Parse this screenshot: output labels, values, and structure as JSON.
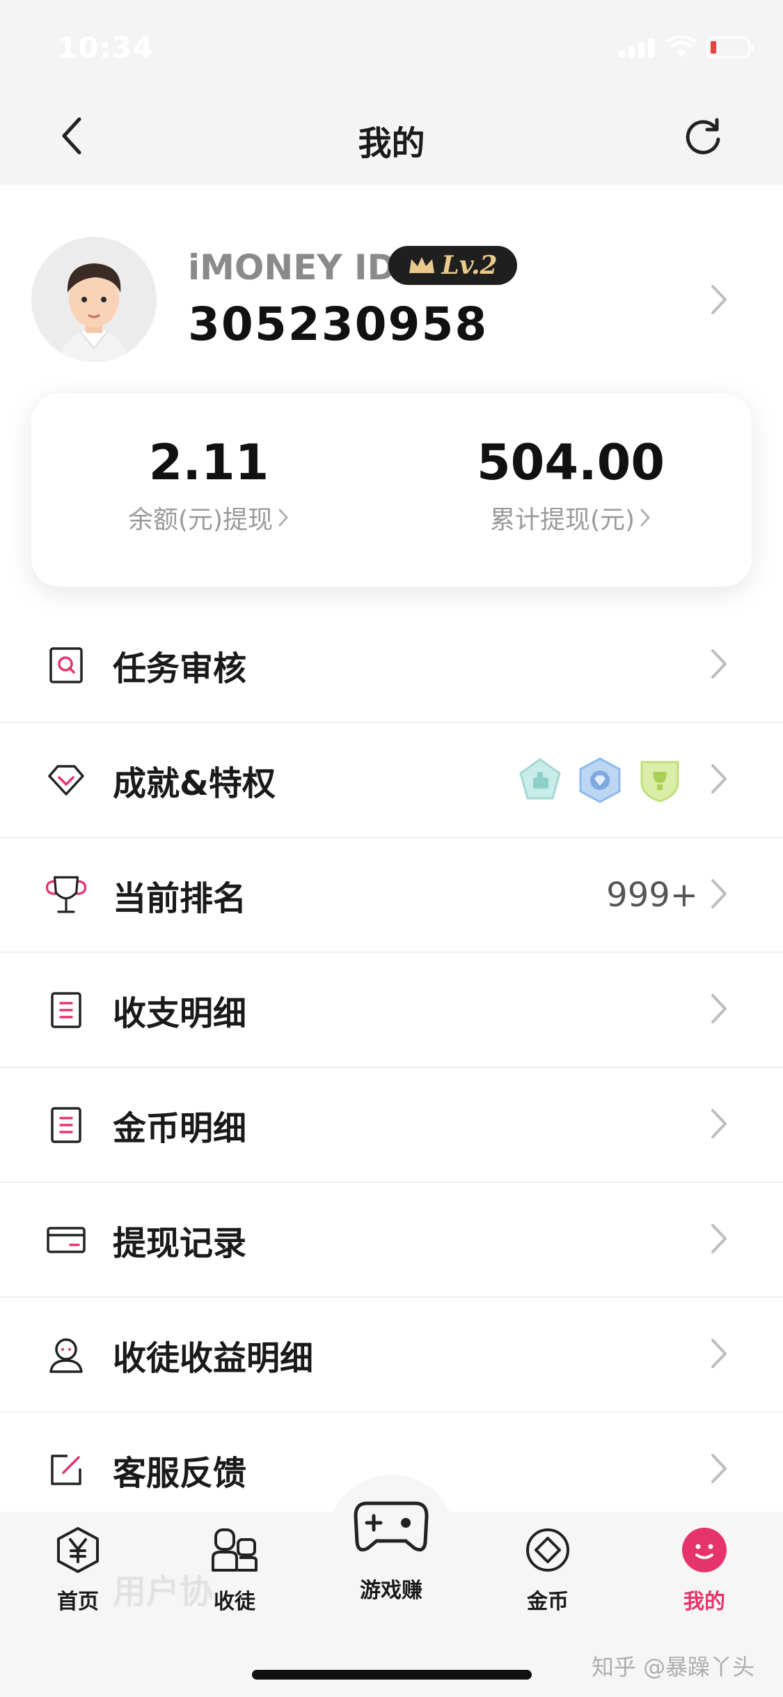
{
  "status": {
    "time": "10:34"
  },
  "nav": {
    "title": "我的"
  },
  "profile": {
    "id_label": "iMONEY ID",
    "level": "Lv.2",
    "id_number": "305230958"
  },
  "balance": {
    "left_value": "2.11",
    "left_label": "余额(元)提现",
    "right_value": "504.00",
    "right_label": "累计提现(元)"
  },
  "menu": [
    {
      "label": "任务审核",
      "icon": "search-doc-icon"
    },
    {
      "label": "成就&特权",
      "icon": "diamond-icon"
    },
    {
      "label": "当前排名",
      "icon": "trophy-icon",
      "value": "999+"
    },
    {
      "label": "收支明细",
      "icon": "list-doc-icon"
    },
    {
      "label": "金币明细",
      "icon": "list-doc-icon"
    },
    {
      "label": "提现记录",
      "icon": "card-icon"
    },
    {
      "label": "收徒收益明细",
      "icon": "user-icon"
    },
    {
      "label": "客服反馈",
      "icon": "edit-icon"
    }
  ],
  "hidden_row": "用户协",
  "tabs": [
    {
      "label": "首页",
      "icon": "yuan-hex-icon"
    },
    {
      "label": "收徒",
      "icon": "apprentice-icon"
    },
    {
      "label": "游戏赚",
      "icon": "gamepad-icon"
    },
    {
      "label": "金币",
      "icon": "coin-icon"
    },
    {
      "label": "我的",
      "icon": "smile-icon",
      "active": true
    }
  ],
  "watermark": "知乎 @暴躁丫头",
  "colors": {
    "accent": "#e6336b",
    "badge_bg": "#1f1f1f",
    "badge_text": "#e9c98c"
  }
}
